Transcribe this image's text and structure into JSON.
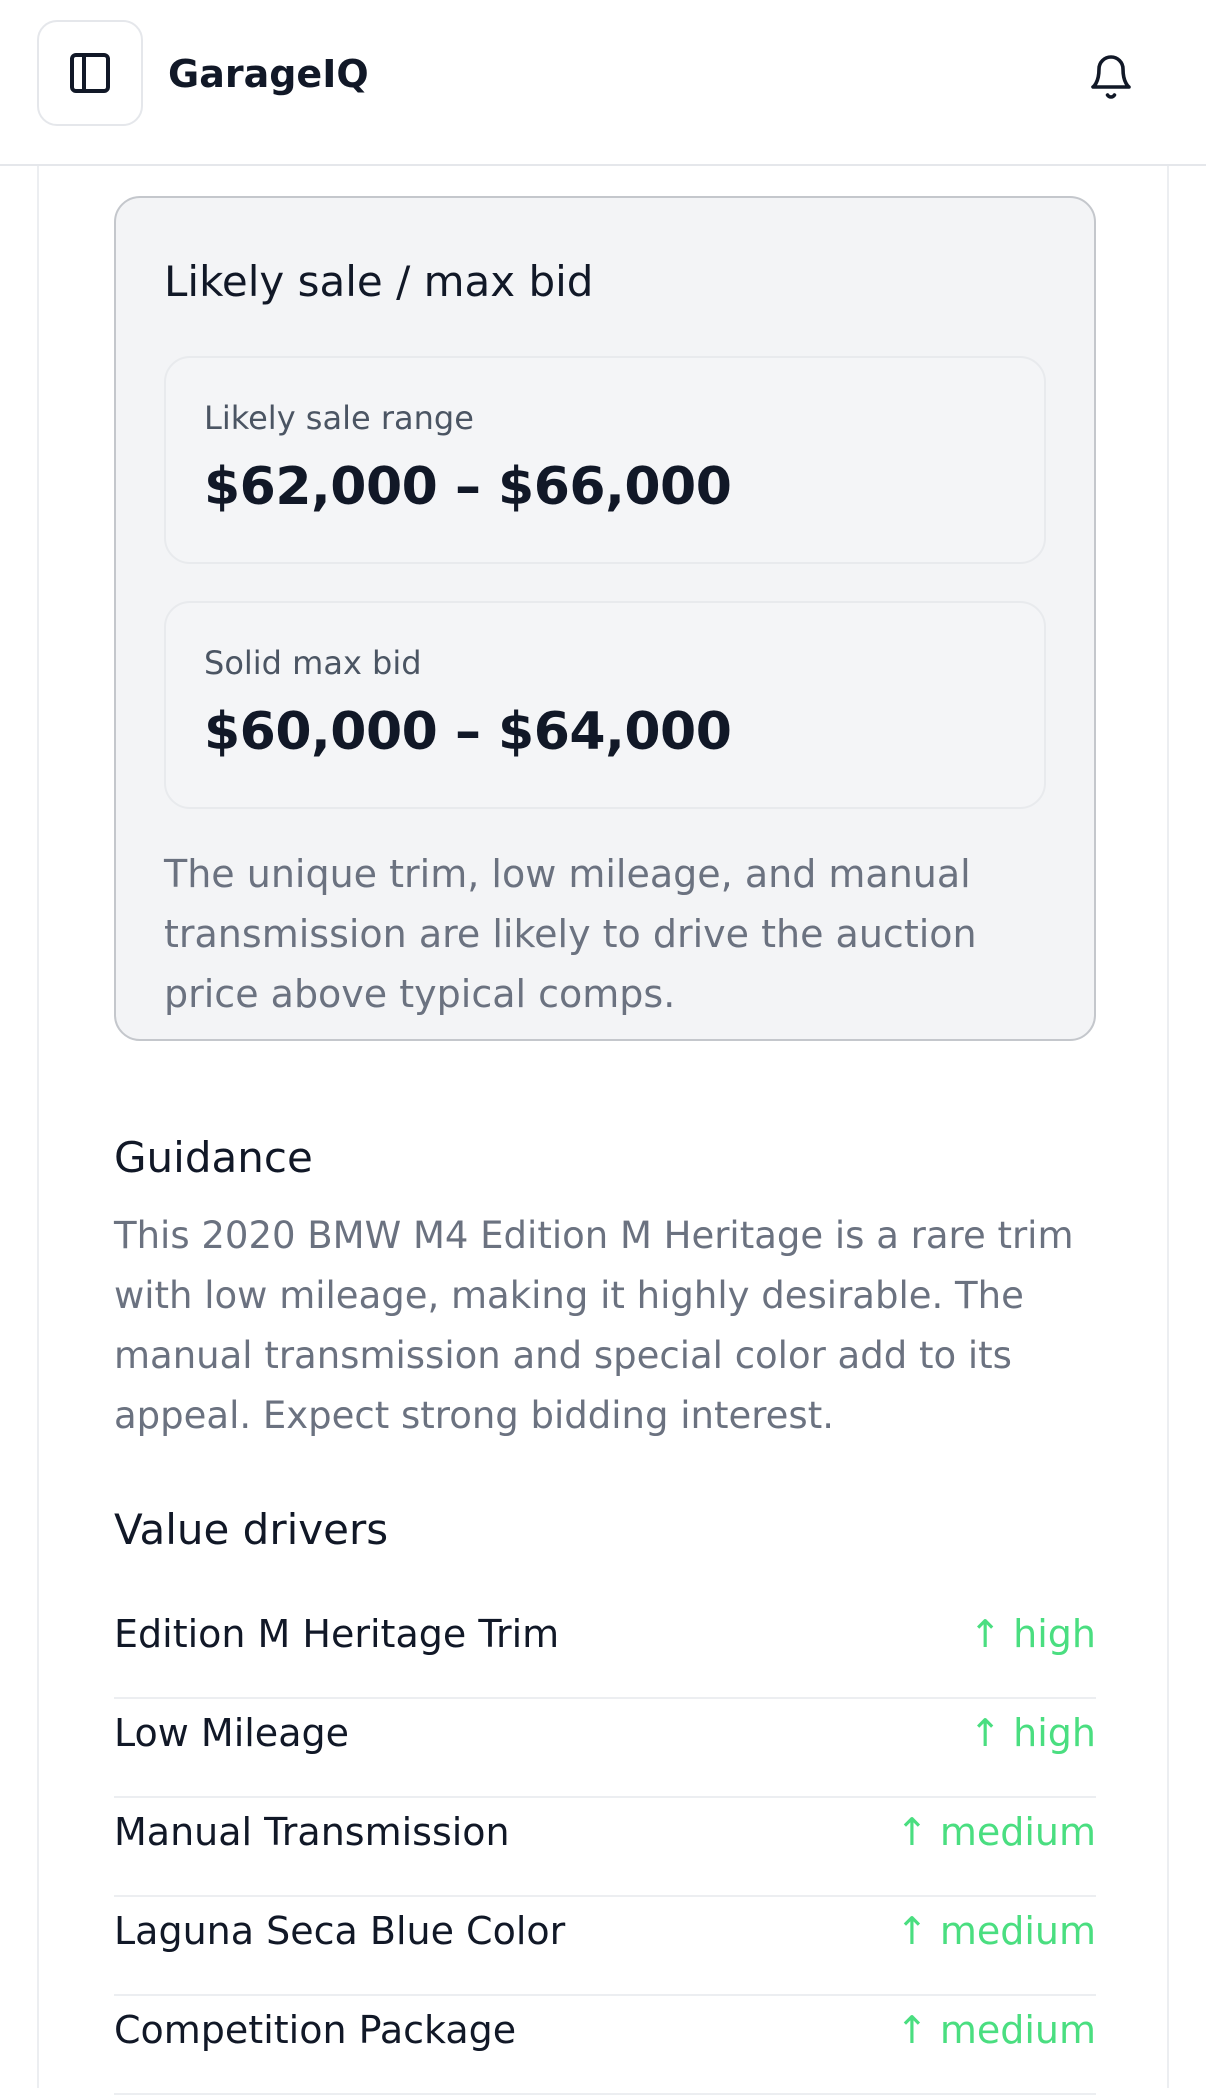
{
  "header": {
    "app_title": "GarageIQ",
    "sidebar_icon": "sidebar-toggle-icon",
    "notification_icon": "bell-icon"
  },
  "bid_card": {
    "title": "Likely sale / max bid",
    "likely_sale": {
      "label": "Likely sale range",
      "value": "$62,000 – $66,000"
    },
    "max_bid": {
      "label": "Solid max bid",
      "value": "$60,000 – $64,000"
    },
    "note": "The unique trim, low mileage, and manual transmission are likely to drive the auction price above typical comps."
  },
  "guidance": {
    "heading": "Guidance",
    "text": "This 2020 BMW M4 Edition M Heritage is a rare trim with low mileage, making it highly desirable. The manual transmission and special color add to its appeal. Expect strong bidding interest."
  },
  "value_drivers": {
    "heading": "Value drivers",
    "items": [
      {
        "name": "Edition M Heritage Trim",
        "arrow": "↑",
        "impact": "high"
      },
      {
        "name": "Low Mileage",
        "arrow": "↑",
        "impact": "high"
      },
      {
        "name": "Manual Transmission",
        "arrow": "↑",
        "impact": "medium"
      },
      {
        "name": "Laguna Seca Blue Color",
        "arrow": "↑",
        "impact": "medium"
      },
      {
        "name": "Competition Package",
        "arrow": "↑",
        "impact": "medium"
      }
    ]
  },
  "colors": {
    "positive_impact": "#4ade80",
    "card_background": "#f3f4f6",
    "muted_text": "#6b7280"
  }
}
